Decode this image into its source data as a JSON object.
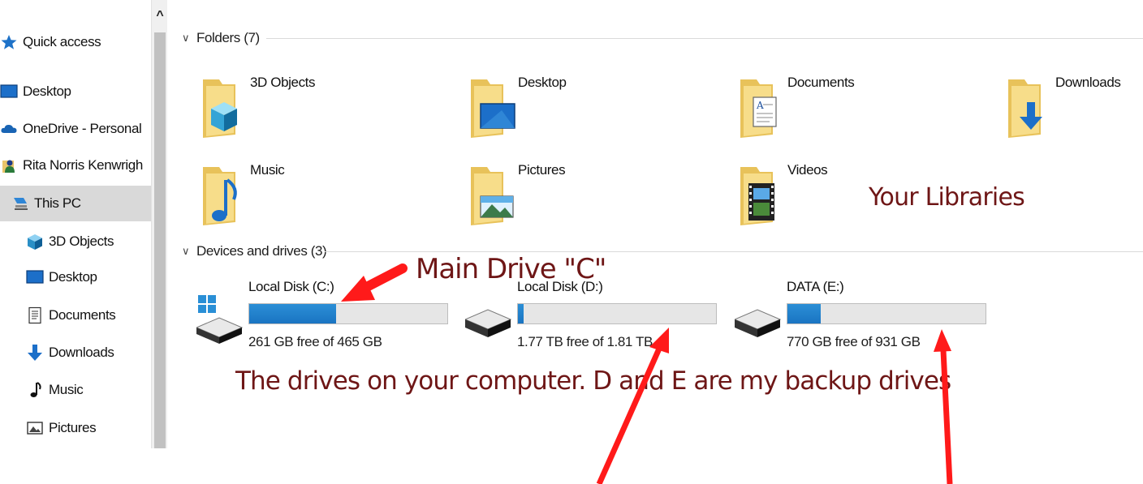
{
  "sidebar": {
    "items": [
      {
        "label": "Quick access",
        "icon": "star-icon"
      },
      {
        "label": "Desktop",
        "icon": "desktop-icon"
      },
      {
        "label": "OneDrive - Personal",
        "icon": "cloud-icon"
      },
      {
        "label": "Rita Norris Kenwrigh",
        "icon": "user-folder-icon"
      },
      {
        "label": "This PC",
        "icon": "computer-icon",
        "selected": true
      },
      {
        "label": "3D Objects",
        "icon": "cube-icon"
      },
      {
        "label": "Desktop",
        "icon": "desktop-icon"
      },
      {
        "label": "Documents",
        "icon": "document-icon"
      },
      {
        "label": "Downloads",
        "icon": "download-arrow-icon"
      },
      {
        "label": "Music",
        "icon": "music-note-icon"
      },
      {
        "label": "Pictures",
        "icon": "picture-icon"
      }
    ],
    "scroll_up": "^"
  },
  "folders": {
    "header": "Folders (7)",
    "items": [
      {
        "label": "3D Objects",
        "icon": "3d-objects-folder-icon"
      },
      {
        "label": "Desktop",
        "icon": "desktop-folder-icon"
      },
      {
        "label": "Documents",
        "icon": "documents-folder-icon"
      },
      {
        "label": "Downloads",
        "icon": "downloads-folder-icon"
      },
      {
        "label": "Music",
        "icon": "music-folder-icon"
      },
      {
        "label": "Pictures",
        "icon": "pictures-folder-icon"
      },
      {
        "label": "Videos",
        "icon": "videos-folder-icon"
      }
    ]
  },
  "drives": {
    "header": "Devices and drives (3)",
    "items": [
      {
        "label": "Local Disk (C:)",
        "free_text": "261 GB free of 465 GB",
        "used_fraction": 0.44,
        "icon": "windows-drive-icon"
      },
      {
        "label": "Local Disk (D:)",
        "free_text": "1.77 TB free of 1.81 TB",
        "used_fraction": 0.03,
        "icon": "hard-drive-icon"
      },
      {
        "label": "DATA (E:)",
        "free_text": "770 GB free of 931 GB",
        "used_fraction": 0.17,
        "icon": "hard-drive-icon"
      }
    ]
  },
  "annotations": {
    "main_drive": "Main Drive \"C\"",
    "libraries": "Your Libraries",
    "drives_note": "The drives on your computer. D and E are my backup drives"
  },
  "colors": {
    "annotation_text": "#6e1616",
    "arrow": "#ff1a1a",
    "bar_fill": "#1a74c2",
    "selected_bg": "#d9d9d9"
  }
}
